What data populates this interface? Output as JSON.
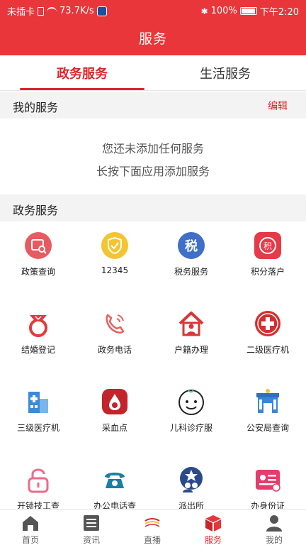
{
  "status_bar": {
    "carrier": "未插卡",
    "speed": "73.7K/s",
    "battery": "100%",
    "time": "下午2:20"
  },
  "header": {
    "title": "服务"
  },
  "tabs": [
    {
      "label": "政务服务",
      "active": true
    },
    {
      "label": "生活服务",
      "active": false
    }
  ],
  "my_services": {
    "label": "我的服务",
    "edit_label": "编辑",
    "empty_line1": "您还未添加任何服务",
    "empty_line2": "长按下面应用添加服务"
  },
  "gov_services": {
    "label": "政务服务",
    "items": [
      {
        "label": "政策查询",
        "icon": "policy-search-icon"
      },
      {
        "label": "12345",
        "icon": "shield-check-icon"
      },
      {
        "label": "税务服务",
        "icon": "tax-icon"
      },
      {
        "label": "积分落户",
        "icon": "points-settle-icon"
      },
      {
        "label": "结婚登记",
        "icon": "ring-icon"
      },
      {
        "label": "政务电话",
        "icon": "phone-icon"
      },
      {
        "label": "户籍办理",
        "icon": "house-person-icon"
      },
      {
        "label": "二级医疗机",
        "icon": "medical-cross-icon"
      },
      {
        "label": "三级医疗机",
        "icon": "hospital-building-icon"
      },
      {
        "label": "采血点",
        "icon": "blood-drop-icon"
      },
      {
        "label": "儿科诊疗服",
        "icon": "baby-face-icon"
      },
      {
        "label": "公安局查询",
        "icon": "police-station-icon"
      },
      {
        "label": "开锁技工查",
        "icon": "lock-icon"
      },
      {
        "label": "办公电话查",
        "icon": "telephone-icon"
      },
      {
        "label": "派出所",
        "icon": "police-badge-icon"
      },
      {
        "label": "办身份证",
        "icon": "id-card-icon"
      }
    ]
  },
  "bottom_nav": [
    {
      "label": "首页",
      "icon": "home-icon",
      "active": false
    },
    {
      "label": "资讯",
      "icon": "news-icon",
      "active": false
    },
    {
      "label": "直播",
      "icon": "live-icon",
      "active": false
    },
    {
      "label": "服务",
      "icon": "service-box-icon",
      "active": true
    },
    {
      "label": "我的",
      "icon": "user-icon",
      "active": false
    }
  ],
  "colors": {
    "brand_red": "#e8363a",
    "active_red": "#d9272e",
    "section_bg": "#f3f3f3"
  }
}
